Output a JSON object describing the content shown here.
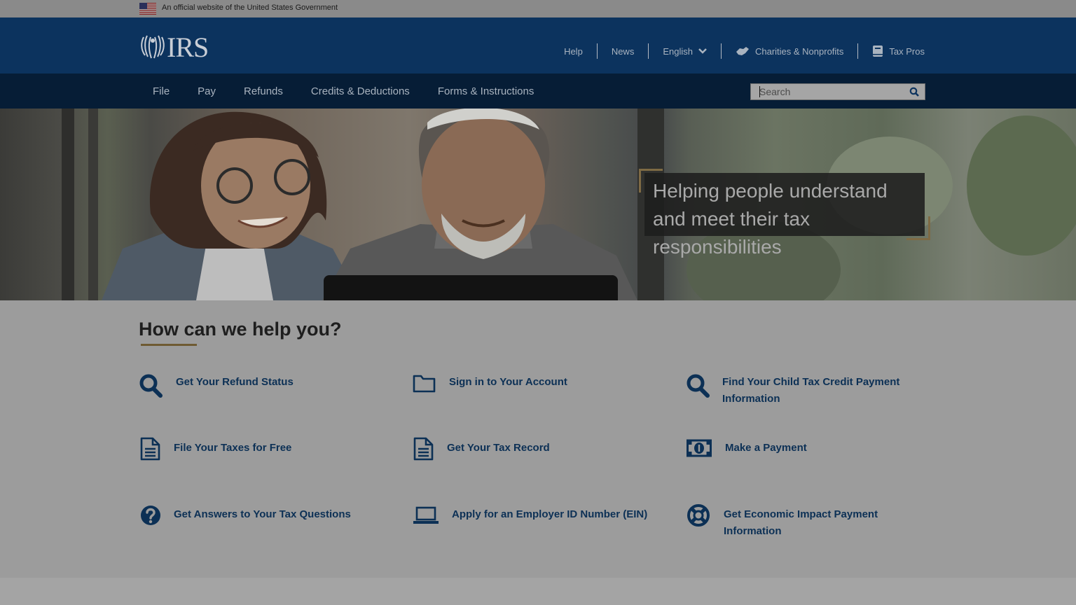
{
  "gov_banner": {
    "text": "An official website of the United States Government"
  },
  "header": {
    "logo_text": "IRS",
    "util_nav": [
      {
        "label": "Help"
      },
      {
        "label": "News"
      },
      {
        "label": "English"
      },
      {
        "label": "Charities & Nonprofits"
      },
      {
        "label": "Tax Pros"
      }
    ]
  },
  "main_nav": {
    "items": [
      {
        "label": "File"
      },
      {
        "label": "Pay"
      },
      {
        "label": "Refunds"
      },
      {
        "label": "Credits & Deductions"
      },
      {
        "label": "Forms & Instructions"
      }
    ],
    "search_placeholder": "Search"
  },
  "hero": {
    "tagline": "Helping people understand and meet their tax responsibilities"
  },
  "help": {
    "title": "How can we help you?",
    "tiles": [
      {
        "label": "Get Your Refund Status",
        "icon": "search-icon"
      },
      {
        "label": "Sign in to Your Account",
        "icon": "folder-icon"
      },
      {
        "label": "Find Your Child Tax Credit Payment Information",
        "icon": "search-icon"
      },
      {
        "label": "File Your Taxes for Free",
        "icon": "document-icon"
      },
      {
        "label": "Get Your Tax Record",
        "icon": "document-icon"
      },
      {
        "label": "Make a Payment",
        "icon": "money-icon"
      },
      {
        "label": "Get Answers to Your Tax Questions",
        "icon": "question-circle-icon"
      },
      {
        "label": "Apply for an Employer ID Number (EIN)",
        "icon": "laptop-icon"
      },
      {
        "label": "Get Economic Impact Payment Information",
        "icon": "lifebuoy-icon"
      }
    ]
  },
  "colors": {
    "header_bg": "#0c335e",
    "nav_bg": "#061d36",
    "link": "#0c3055",
    "accent_gold": "#7e6a44"
  }
}
